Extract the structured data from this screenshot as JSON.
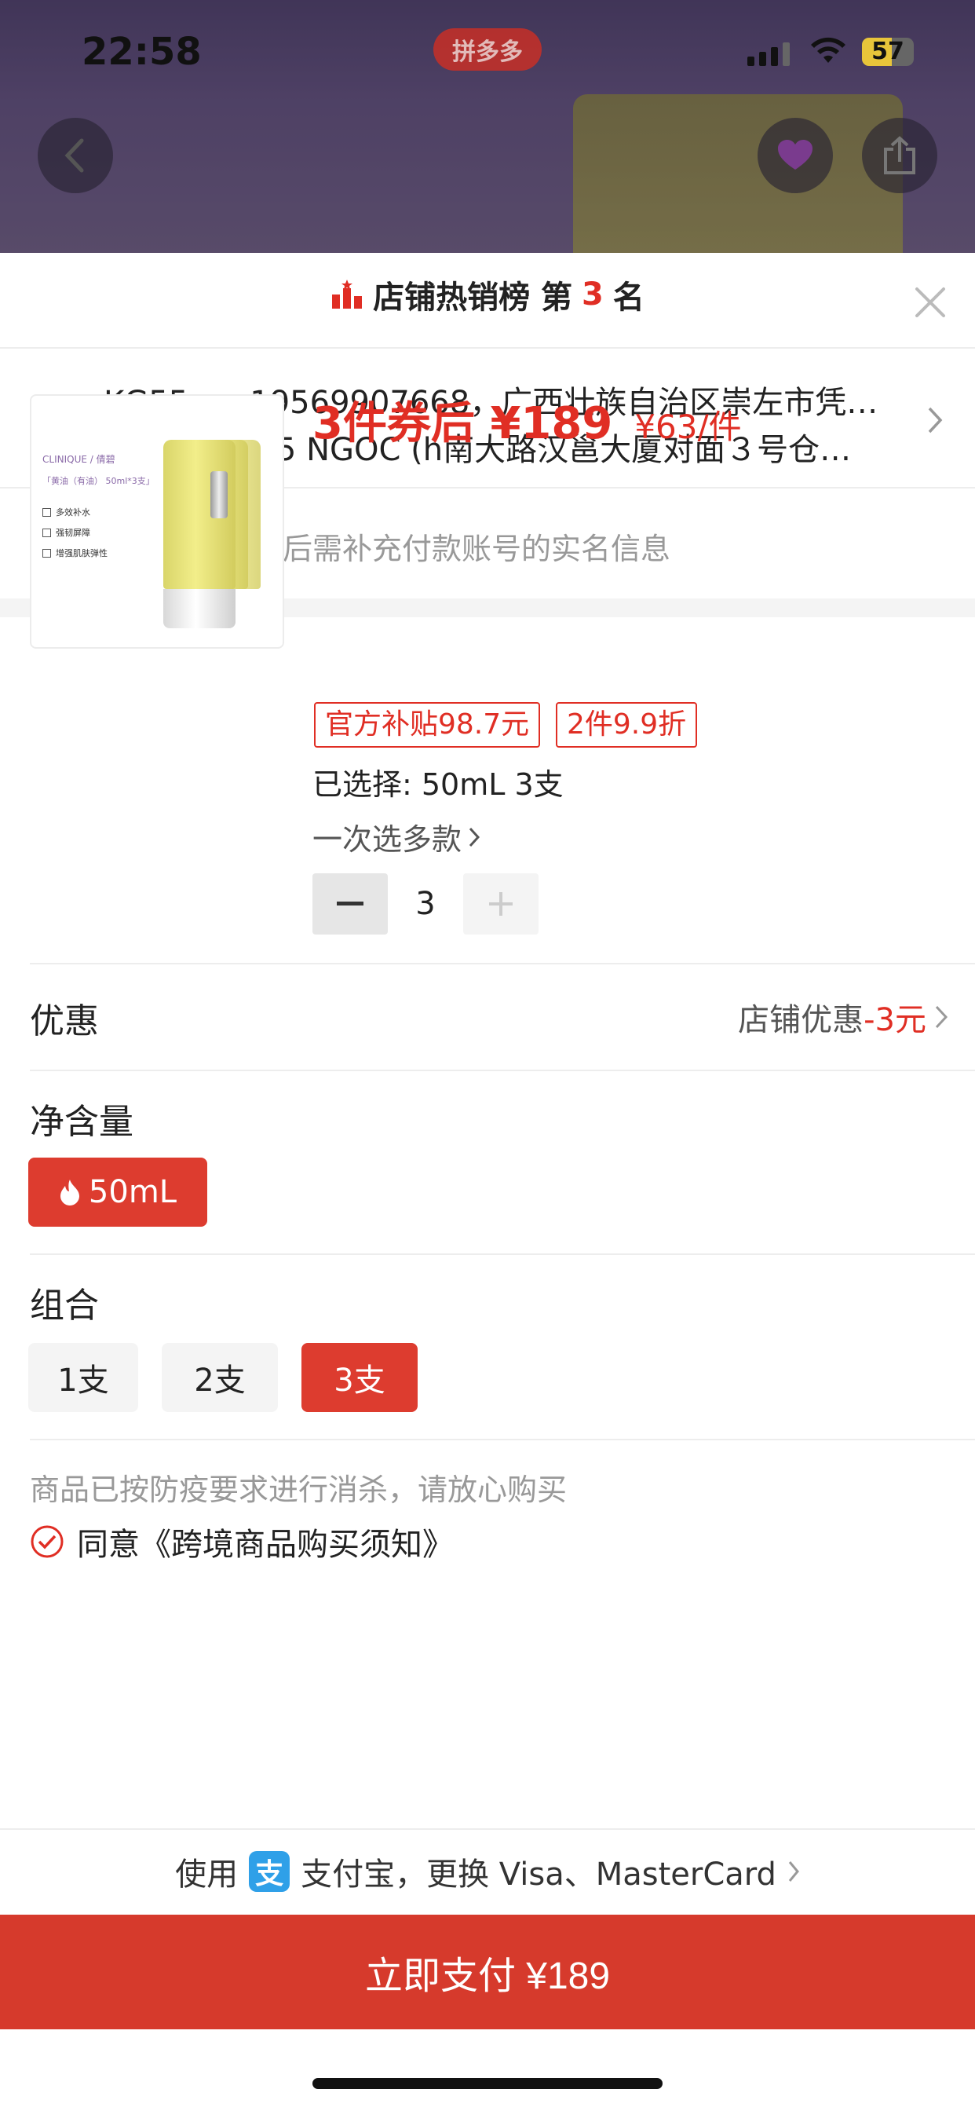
{
  "status_bar": {
    "time": "22:58",
    "app_badge": "拼多多",
    "battery": "57"
  },
  "header_icons": {
    "back": "back-arrow-icon",
    "favorite": "heart-icon",
    "share": "share-icon"
  },
  "rank": {
    "prefix": "店铺热销榜 第",
    "number": "3",
    "suffix": "名"
  },
  "address": {
    "line1": "KG55...，19569907668，广西壮族自治区崇左市凭…",
    "line2": "KG55 TT105 NGOC (h南大路汉邕大厦对面３号仓…"
  },
  "id_notice": "跨境商品拼单后需补充付款账号的实名信息",
  "product": {
    "image_brand": "CLINIQUE / 倩碧",
    "image_spec": "「黄油（有油） 50ml*3支」",
    "image_features": [
      "多效补水",
      "强韧屏障",
      "增强肌肤弹性"
    ],
    "price_main": "3件券后 ¥189",
    "price_unit": "¥63/件",
    "tag_subsidy": "官方补贴98.7元",
    "tag_discount": "2件9.9折",
    "selected": "已选择: 50mL 3支",
    "multi_select": "一次选多款",
    "quantity": "3"
  },
  "promo": {
    "label": "优惠",
    "value_prefix": "店铺优惠",
    "value_amount": "-3元"
  },
  "volume": {
    "title": "净含量",
    "options": [
      {
        "label": "50mL",
        "selected": true
      }
    ]
  },
  "combo": {
    "title": "组合",
    "options": [
      {
        "label": "1支",
        "selected": false
      },
      {
        "label": "2支",
        "selected": false
      },
      {
        "label": "3支",
        "selected": true
      }
    ]
  },
  "notice": "商品已按防疫要求进行消杀，请放心购买",
  "agreement": "同意《跨境商品购买须知》",
  "payment": {
    "use": "使用",
    "alipay_glyph": "支",
    "method": "支付宝，更换 Visa、MasterCard"
  },
  "pay_button": "立即支付 ¥189",
  "colors": {
    "accent": "#e02e24",
    "button": "#d63a2c",
    "alipay": "#2fa0e8"
  }
}
